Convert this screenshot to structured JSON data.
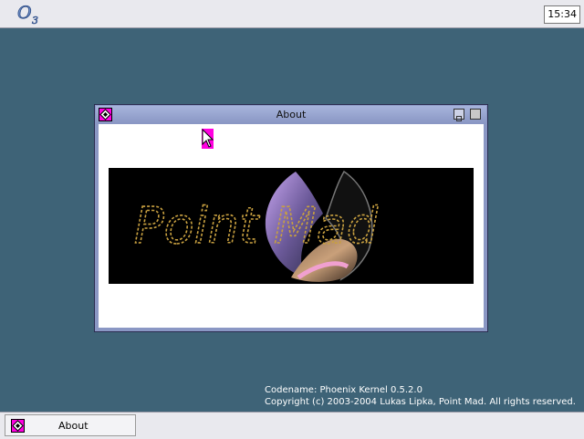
{
  "topbar": {
    "logo_icon": "o3-logo-icon",
    "clock": "15:34"
  },
  "window": {
    "title": "About",
    "icon": "diamond-app-icon",
    "banner_text": "Point Mad"
  },
  "info": {
    "codename": "Codename: Phoenix Kernel 0.5.2.0",
    "copyright": "Copyright (c) 2003-2004 Lukas Lipka, Point Mad. All rights reserved."
  },
  "taskbar": {
    "items": [
      {
        "label": "About",
        "icon": "diamond-app-icon"
      }
    ]
  },
  "colors": {
    "desktop": "#3e6377",
    "accent_icon": "#ff00e0",
    "window_frame": "#8a97c4"
  }
}
